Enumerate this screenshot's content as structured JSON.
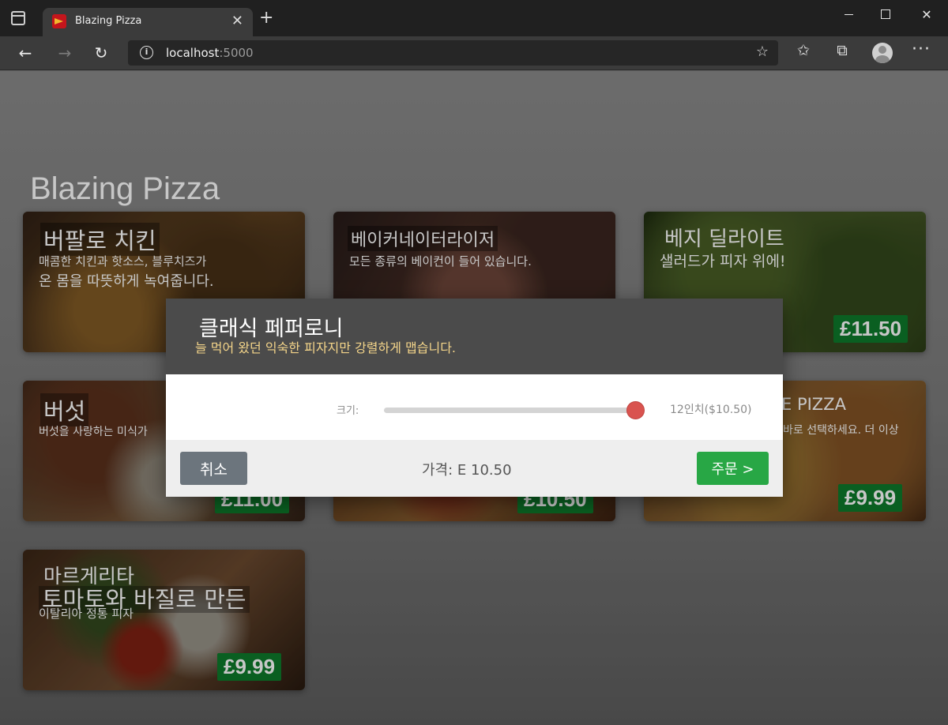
{
  "browser": {
    "tab_title": "Blazing Pizza",
    "tab_close_glyph": "✕",
    "new_tab_glyph": "+",
    "url_host": "localhost",
    "url_port": ":5000",
    "window_controls": {
      "close_glyph": "✕"
    },
    "nav": {
      "back_glyph": "←",
      "forward_glyph": "→",
      "refresh_glyph": "↻"
    }
  },
  "page": {
    "brand": "Blazing Pizza",
    "cards": [
      {
        "title": "버팔로 치킨",
        "desc_line1": "매콤한 치킨과 핫소스, 블루치즈가",
        "desc_line2": "온 몸을 따뜻하게 녹여줍니다.",
        "price": ""
      },
      {
        "title": "베이커네이터라이저",
        "desc_line1": "모든 종류의 베이컨이 들어 있습니다.",
        "desc_line2": "",
        "price": ""
      },
      {
        "title": "베지 딜라이트",
        "desc_line1": "샐러드가 피자 위에!",
        "desc_line2": "",
        "price": "£11.50"
      },
      {
        "title": "버섯",
        "desc_line1": "버섯을 사랑하는 미식가",
        "desc_line2": "",
        "price": "£11.00"
      },
      {
        "title": "",
        "desc_line1": "",
        "desc_line2": "",
        "price": "£10.50"
      },
      {
        "title": "E PIZZA",
        "desc_line1": "바로 선택하세요. 더 이상",
        "desc_line2": "",
        "price": "£9.99"
      },
      {
        "title": "마르게리타",
        "desc_line1": "토마토와 바질로 만든",
        "desc_line2": "이탈리아 정통 피자",
        "price": "£9.99"
      }
    ]
  },
  "dialog": {
    "title": "클래식 페퍼로니",
    "description": "늘 먹어 왔던 익숙한 피자지만 강렬하게 맵습니다.",
    "size_label": "크기:",
    "size_value": "12인치($10.50)",
    "size_slider_fraction": 1.0,
    "total_price": "가격: E 10.50",
    "cancel_label": "취소",
    "order_label": "주문 >"
  }
}
